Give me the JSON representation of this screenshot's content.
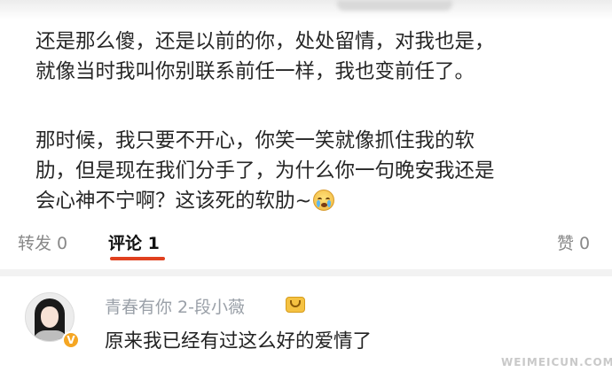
{
  "post": {
    "paragraph1": [
      "还是那么傻，还是以前的你，处处留情，对我也是，",
      "就像当时我叫你别联系前任一样，我也变前任了。"
    ],
    "paragraph2": [
      "那时候，我只要不开心，你笑一笑就像抓住我的软",
      "肋，但是现在我们分手了，为什么你一句晚安我还是",
      "会心神不宁啊？这该死的软肋~"
    ],
    "emoji_icon": "crying-face-icon"
  },
  "actions": {
    "repost_label": "转发 0",
    "comment_label": "评论 1",
    "like_label": "赞 0",
    "active_color": "#e0401f"
  },
  "comment": {
    "username": "青春有你 2-段小薇",
    "verified_icon": "verified-v-icon",
    "verified_mark": "V",
    "badge_icon": "crown-badge-icon",
    "text": "原来我已经有过这么好的爱情了"
  },
  "watermark": "WEIMEICUN.COM"
}
